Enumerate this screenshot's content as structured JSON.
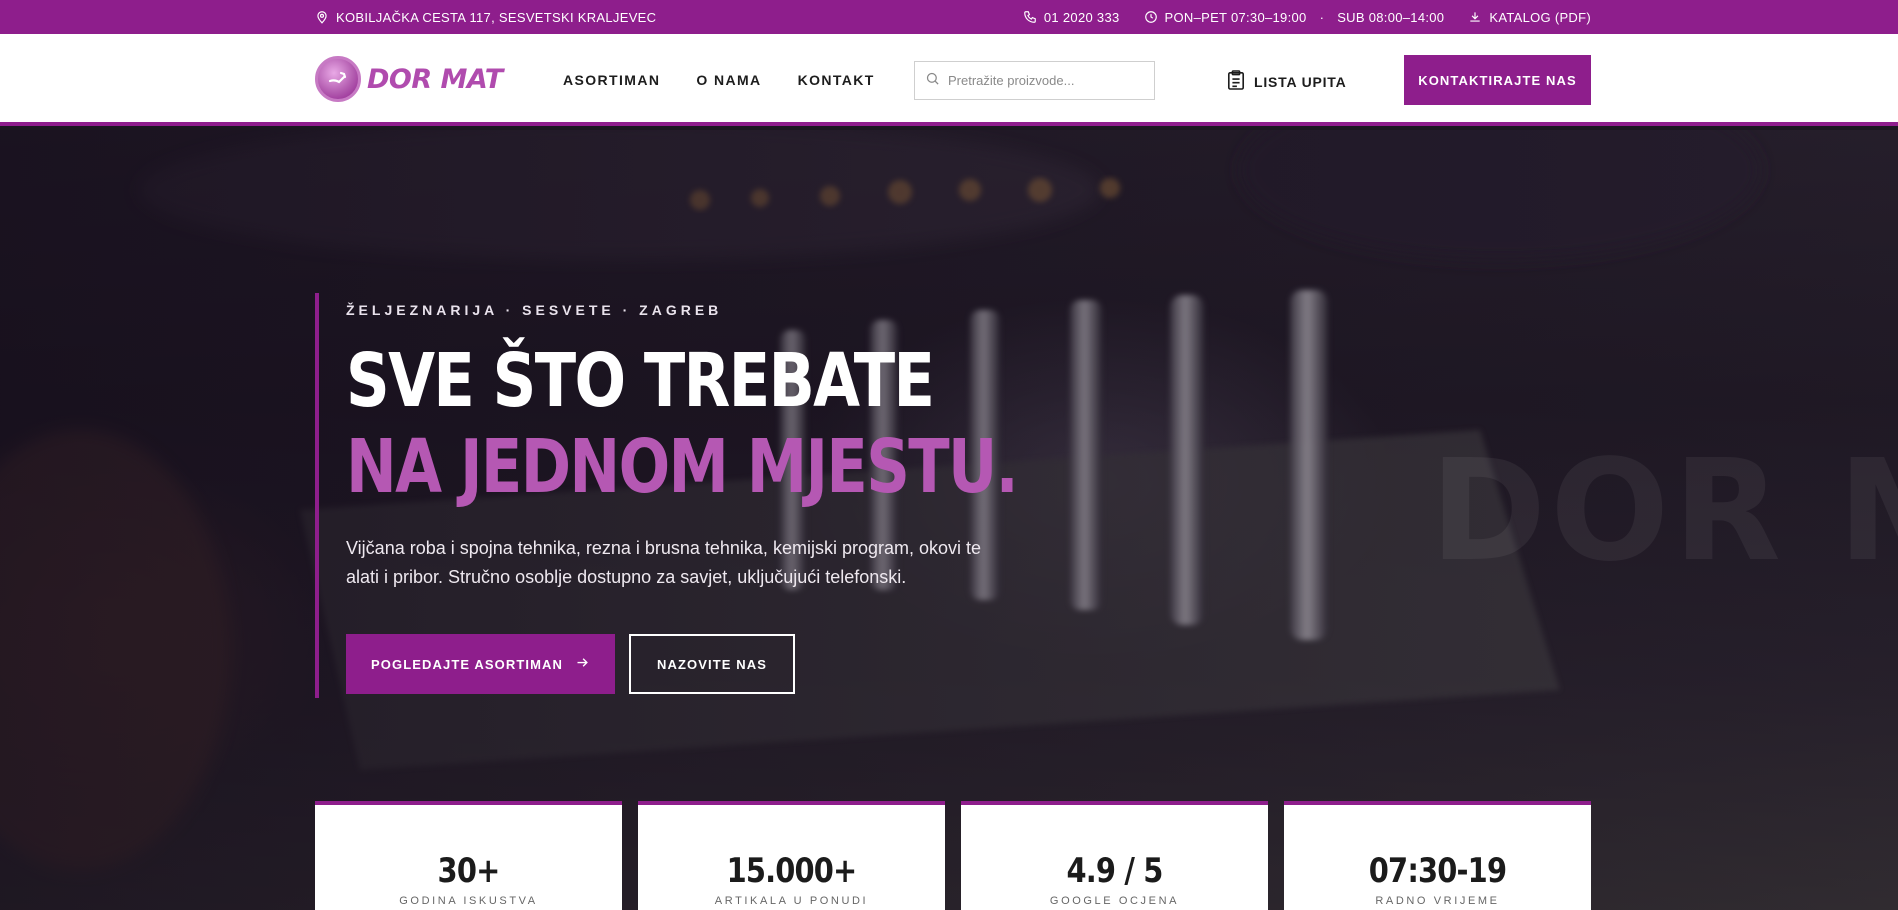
{
  "topbar": {
    "address": "KOBILJAČKA CESTA 117, SESVETSKI KRALJEVEC",
    "phone": "01 2020 333",
    "hours_weekday": "PON–PET 07:30–19:00",
    "hours_sep": "·",
    "hours_saturday": "SUB 08:00–14:00",
    "catalog": "KATALOG (PDF)"
  },
  "header": {
    "logo_text": "DOR MAT",
    "nav": [
      "ASORTIMAN",
      "O NAMA",
      "KONTAKT"
    ],
    "search_placeholder": "Pretražite proizvode...",
    "inquiry_list": "LISTA UPITA",
    "cta": "KONTAKTIRAJTE NAS"
  },
  "hero": {
    "watermark": "DOR MAT",
    "eyebrow": "ŽELJEZNARIJA · SESVETE · ZAGREB",
    "title_line1": "SVE ŠTO TREBATE",
    "title_line2": "NA JEDNOM MJESTU.",
    "lead": "Vijčana roba i spojna tehnika, rezna i brusna tehnika, kemijski program, okovi te alati i pribor. Stručno osoblje dostupno za savjet, uključujući telefonski.",
    "primary_button": "POGLEDAJTE ASORTIMAN",
    "secondary_button": "NAZOVITE NAS"
  },
  "stats": [
    {
      "value": "30+",
      "label": "GODINA ISKUSTVA"
    },
    {
      "value": "15.000+",
      "label": "ARTIKALA U PONUDI"
    },
    {
      "value": "4.9 / 5",
      "label": "GOOGLE OCJENA"
    },
    {
      "value": "07:30-19",
      "label": "RADNO VRIJEME"
    }
  ],
  "colors": {
    "brand": "#8e1e8c",
    "accent_text": "#b558b3"
  }
}
